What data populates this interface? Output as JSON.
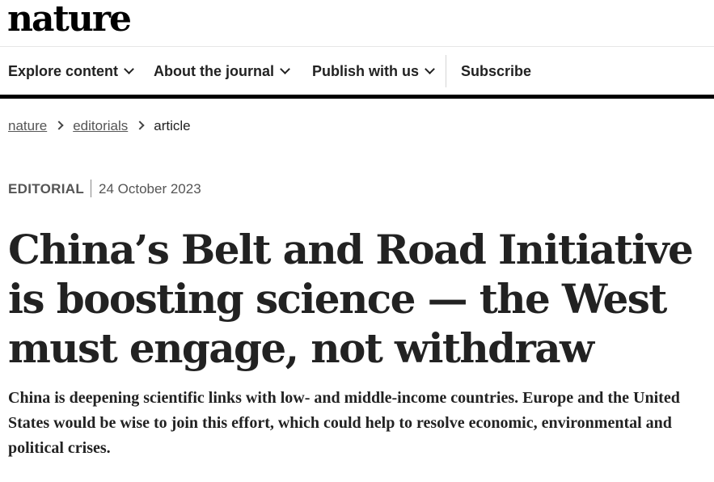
{
  "brand": {
    "logo_text": "nature"
  },
  "nav": {
    "items": [
      {
        "label": "Explore content",
        "has_dropdown": true
      },
      {
        "label": "About the journal",
        "has_dropdown": true
      },
      {
        "label": "Publish with us",
        "has_dropdown": true
      },
      {
        "label": "Subscribe",
        "has_dropdown": false
      }
    ]
  },
  "breadcrumb": {
    "items": [
      "nature",
      "editorials",
      "article"
    ]
  },
  "article": {
    "type": "EDITORIAL",
    "date": "24 October 2023",
    "title": "China’s Belt and Road Initiative is boosting science — the West must engage, not withdraw",
    "standfirst": "China is deepening scientific links with low- and middle-income countries. Europe and the United States would be wise to join this effort, which could help to resolve economic, environmental and political crises."
  },
  "colors": {
    "text": "#222222",
    "nav_rule": "#000000",
    "muted": "#555555"
  }
}
